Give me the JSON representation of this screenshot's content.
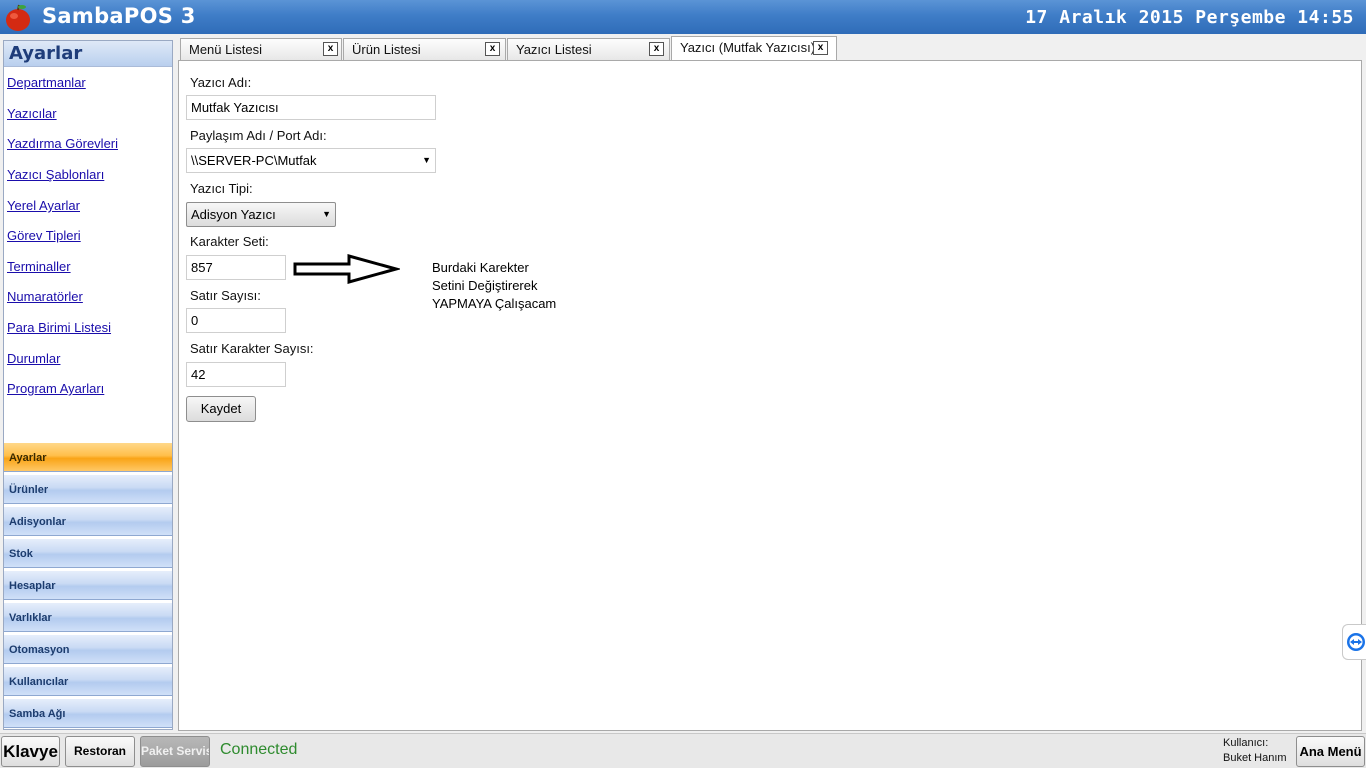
{
  "app": {
    "title": "SambaPOS 3",
    "clock": "17 Aralık 2015 Perşembe 14:55"
  },
  "sidebar": {
    "header": "Ayarlar",
    "links": [
      "Departmanlar",
      "Yazıcılar",
      "Yazdırma Görevleri",
      "Yazıcı Şablonları",
      "Yerel Ayarlar",
      "Görev Tipleri",
      "Terminaller",
      "Numaratörler",
      "Para Birimi Listesi",
      "Durumlar",
      "Program Ayarları"
    ],
    "nav": [
      "Ayarlar",
      "Ürünler",
      "Adisyonlar",
      "Stok",
      "Hesaplar",
      "Varlıklar",
      "Otomasyon",
      "Kullanıcılar",
      "Samba Ağı"
    ],
    "active_nav": "Ayarlar"
  },
  "tabs": [
    {
      "label": "Menü Listesi",
      "close": "x"
    },
    {
      "label": "Ürün Listesi",
      "close": "x"
    },
    {
      "label": "Yazıcı Listesi",
      "close": "x"
    },
    {
      "label": "Yazıcı (Mutfak Yazıcısı)",
      "close": "x"
    }
  ],
  "form": {
    "printer_name_label": "Yazıcı Adı:",
    "printer_name_value": "Mutfak Yazıcısı",
    "share_label": "Paylaşım Adı / Port Adı:",
    "share_value": "\\\\SERVER-PC\\Mutfak",
    "type_label": "Yazıcı Tipi:",
    "type_value": "Adisyon Yazıcı",
    "charset_label": "Karakter Seti:",
    "charset_value": "857",
    "line_count_label": "Satır Sayısı:",
    "line_count_value": "0",
    "line_chars_label": "Satır Karakter Sayısı:",
    "line_chars_value": "42",
    "save_label": "Kaydet"
  },
  "annotation": {
    "line1": "Burdaki Karekter",
    "line2": "Setini Değiştirerek",
    "line3": "YAPMAYA Çalışacam"
  },
  "bottombar": {
    "keyboard": "Klavye",
    "restoran": "Restoran",
    "paket": "Paket Servis",
    "status": "Connected",
    "user_label": "Kullanıcı:",
    "user_name": "Buket Hanım",
    "main_menu": "Ana Menü"
  }
}
